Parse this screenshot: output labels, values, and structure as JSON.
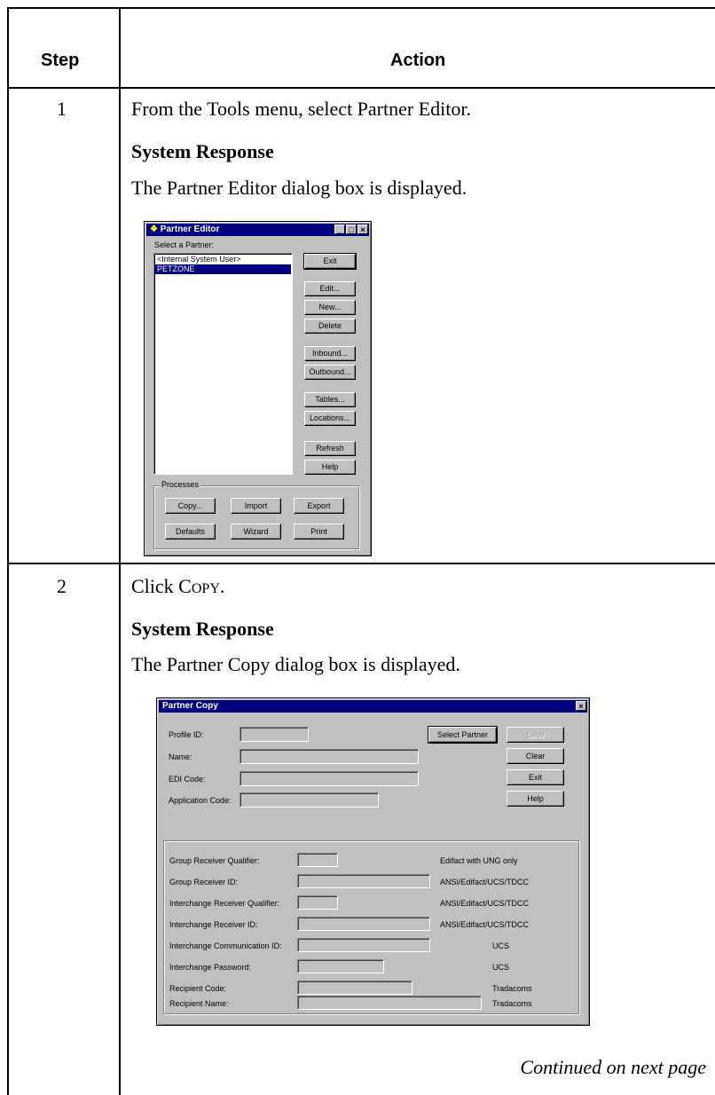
{
  "table": {
    "header_step": "Step",
    "header_action": "Action",
    "continued": "Continued on next page"
  },
  "steps": [
    {
      "number": "1",
      "instruction": "From the Tools menu, select Partner Editor.",
      "response_heading": "System Response",
      "response_text": "The Partner Editor dialog box is displayed."
    },
    {
      "number": "2",
      "instruction_prefix": "Click ",
      "instruction_sc_first": "C",
      "instruction_sc_rest": "OPY",
      "instruction_suffix": ".",
      "response_heading": "System Response",
      "response_text": "The Partner Copy dialog box is displayed."
    }
  ],
  "partner_editor": {
    "title": "Partner Editor",
    "select_label": "Select a Partner:",
    "partners": [
      "<Internal System User>",
      "PETZONE"
    ],
    "selected_index": 1,
    "buttons": {
      "exit": "Exit",
      "edit": "Edit...",
      "new": "New...",
      "delete": "Delete",
      "inbound": "Inbound...",
      "outbound": "Outbound...",
      "tables": "Tables...",
      "locations": "Locations...",
      "refresh": "Refresh",
      "help": "Help"
    },
    "processes_label": "Processes",
    "process_buttons": {
      "copy": "Copy...",
      "import": "Import",
      "export": "Export",
      "defaults": "Defaults",
      "wizard": "Wizard",
      "print": "Print"
    }
  },
  "partner_copy": {
    "title": "Partner Copy",
    "labels": {
      "profile_id": "Profile ID:",
      "name": "Name:",
      "edi_code": "EDI Code:",
      "application_code": "Application Code:"
    },
    "buttons": {
      "select_partner": "Select Partner",
      "save": "Save",
      "clear": "Clear",
      "exit": "Exit",
      "help": "Help"
    },
    "rows": [
      {
        "label": "Group Receiver Qualifier:",
        "note": "Edifact with UNG only"
      },
      {
        "label": "Group Receiver ID:",
        "note": "ANSI/Edifact/UCS/TDCC"
      },
      {
        "label": "Interchange Receiver Qualifier:",
        "note": "ANSI/Edifact/UCS/TDCC"
      },
      {
        "label": "Interchange Receiver ID:",
        "note": "ANSI/Edifact/UCS/TDCC"
      },
      {
        "label": "Interchange Communication ID:",
        "note": "UCS"
      },
      {
        "label": "Interchange Password:",
        "note": "UCS"
      },
      {
        "label": "Recipient Code:",
        "note": "Tradacoms"
      },
      {
        "label": "Recipient Name:",
        "note": "Tradacoms"
      }
    ]
  }
}
